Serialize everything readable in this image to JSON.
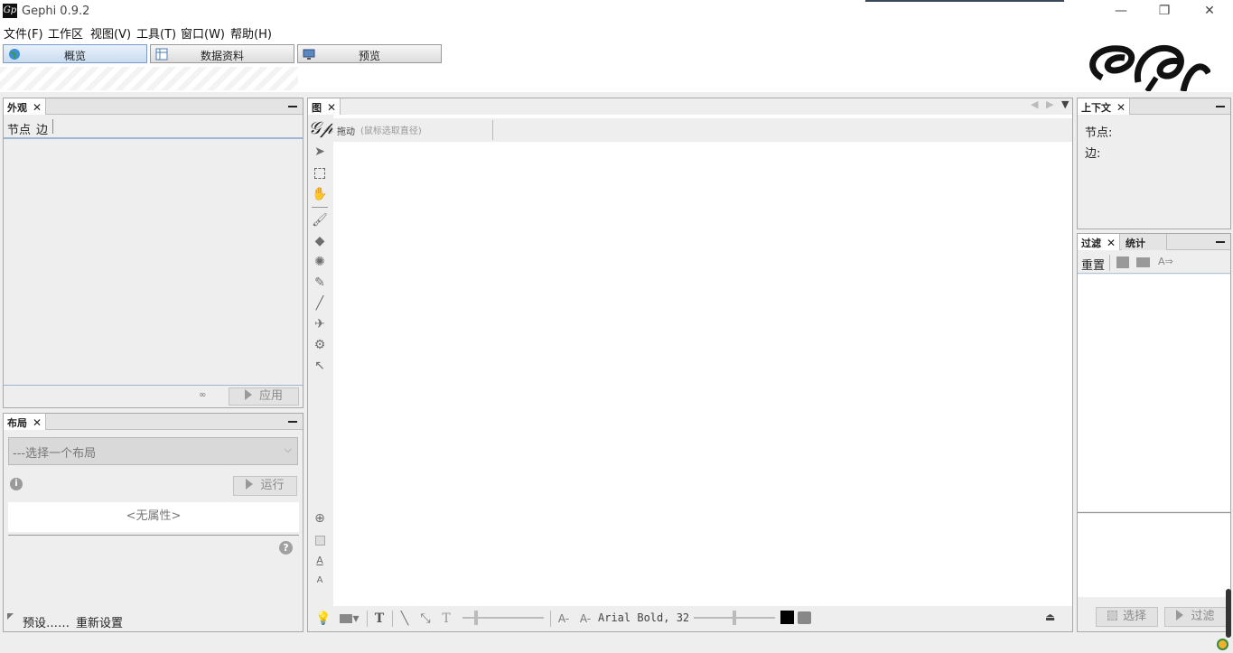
{
  "window": {
    "title": "Gephi 0.9.2",
    "icon_label": "Gp",
    "minimize_glyph": "—",
    "maximize_glyph": "❐",
    "close_glyph": "✕"
  },
  "menu": [
    "文件(F)",
    "工作区",
    "视图(V)",
    "工具(T)",
    "窗口(W)",
    "帮助(H)"
  ],
  "workspace_tabs": [
    {
      "label": "概览",
      "icon": "globe-icon",
      "active": true
    },
    {
      "label": "数据资料",
      "icon": "table-icon",
      "active": false
    },
    {
      "label": "预览",
      "icon": "monitor-icon",
      "active": false
    }
  ],
  "appearance": {
    "tab": "外观",
    "subtabs": [
      "节点",
      "边"
    ],
    "apply_label": "应用",
    "dots": "∞"
  },
  "layout": {
    "tab": "布局",
    "select_placeholder": "---选择一个布局",
    "run_label": "运行",
    "no_properties": "<无属性>",
    "presets_label": "预设……",
    "reset_label": "重新设置",
    "info_glyph": "i",
    "help_glyph": "?"
  },
  "graph": {
    "tab": "图",
    "toolbar_hint": "拖动",
    "toolbar_hint_sub": "(鼠标选取直径)",
    "logo_glyph": "𝒢𝓅",
    "font_label": "Arial Bold, 32",
    "text_glyph": "T",
    "font_decrease": "A-",
    "font_increase": "A-",
    "zoom_in_glyph": "⊕",
    "small_text_glyph": "A"
  },
  "context": {
    "tab": "上下文",
    "nodes_label": "节点:",
    "edges_label": "边:"
  },
  "filters": {
    "tab_filter": "过滤",
    "tab_stats": "统计",
    "reset_label": "重置",
    "select_label": "选择",
    "filter_label": "过滤"
  },
  "colors": {
    "accent_tab": "#c9dcf0",
    "panel_bg": "#eeeeee",
    "canvas_bg": "#ffffff"
  }
}
